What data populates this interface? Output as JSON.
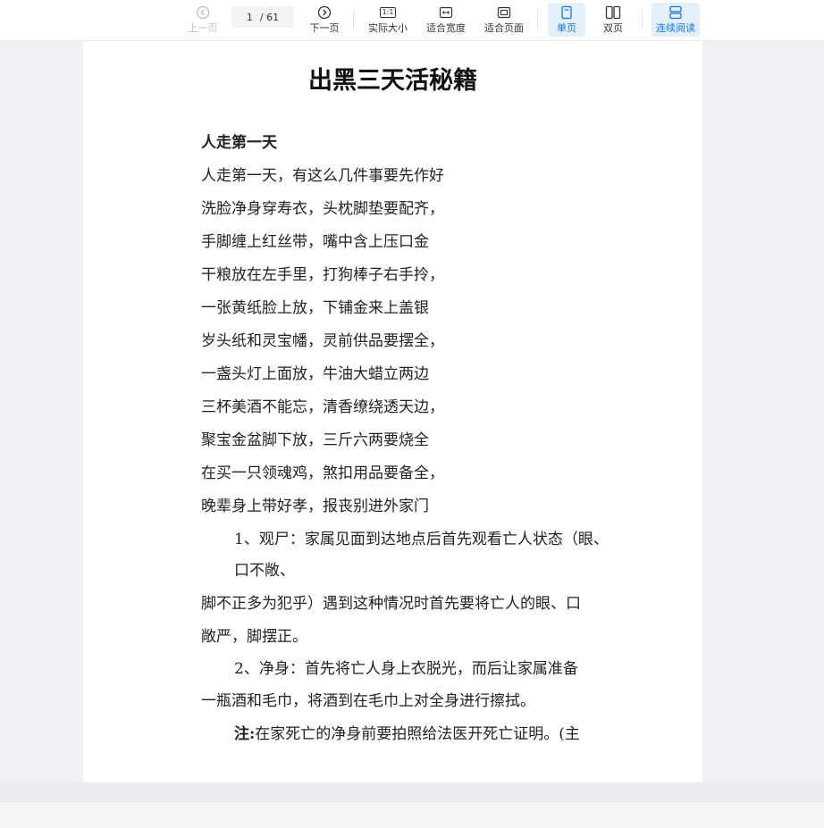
{
  "toolbar": {
    "prev_label": "上一页",
    "current_page": "1",
    "total_pages": "/ 61",
    "next_label": "下一页",
    "actual_size_label": "实际大小",
    "actual_size_icon_text": "1:1",
    "fit_width_label": "适合宽度",
    "fit_page_label": "适合页面",
    "single_page_label": "单页",
    "double_page_label": "双页",
    "continuous_label": "连续阅读",
    "accent_color": "#1677d2"
  },
  "document": {
    "title": "出黑三天活秘籍",
    "lines": [
      {
        "text": "人走第一天",
        "bold": true
      },
      {
        "text": "人走第一天，有这么几件事要先作好"
      },
      {
        "text": "洗脸净身穿寿衣，头枕脚垫要配齐，"
      },
      {
        "text": "手脚缠上红丝带，嘴中含上压口金"
      },
      {
        "text": "干粮放在左手里，打狗棒子右手拎，"
      },
      {
        "text": "一张黄纸脸上放，下铺金来上盖银"
      },
      {
        "text": "岁头纸和灵宝幡，灵前供品要摆全，"
      },
      {
        "text": "一盏头灯上面放，牛油大蜡立两边"
      },
      {
        "text": "三杯美酒不能忘，清香缭绕透天边，"
      },
      {
        "text": "聚宝金盆脚下放，三斤六两要烧全"
      },
      {
        "text": "在买一只领魂鸡，煞扣用品要备全，"
      },
      {
        "text": "晚辈身上带好孝，报丧别进外家门"
      },
      {
        "text": "1、观尸：家属见面到达地点后首先观看亡人状态（眼、"
      },
      {
        "text": "口不敞、"
      },
      {
        "text": "脚不正多为犯乎）遇到这种情况时首先要将亡人的眼、口"
      },
      {
        "text": "敞严，脚摆正。"
      },
      {
        "text": "2、净身：首先将亡人身上衣脱光，而后让家属准备"
      },
      {
        "text": "一瓶酒和毛巾，将酒到在毛巾上对全身进行擦拭。"
      },
      {
        "note_label": "注:",
        "text": "在家死亡的净身前要拍照给法医开死亡证明。(主"
      }
    ]
  }
}
